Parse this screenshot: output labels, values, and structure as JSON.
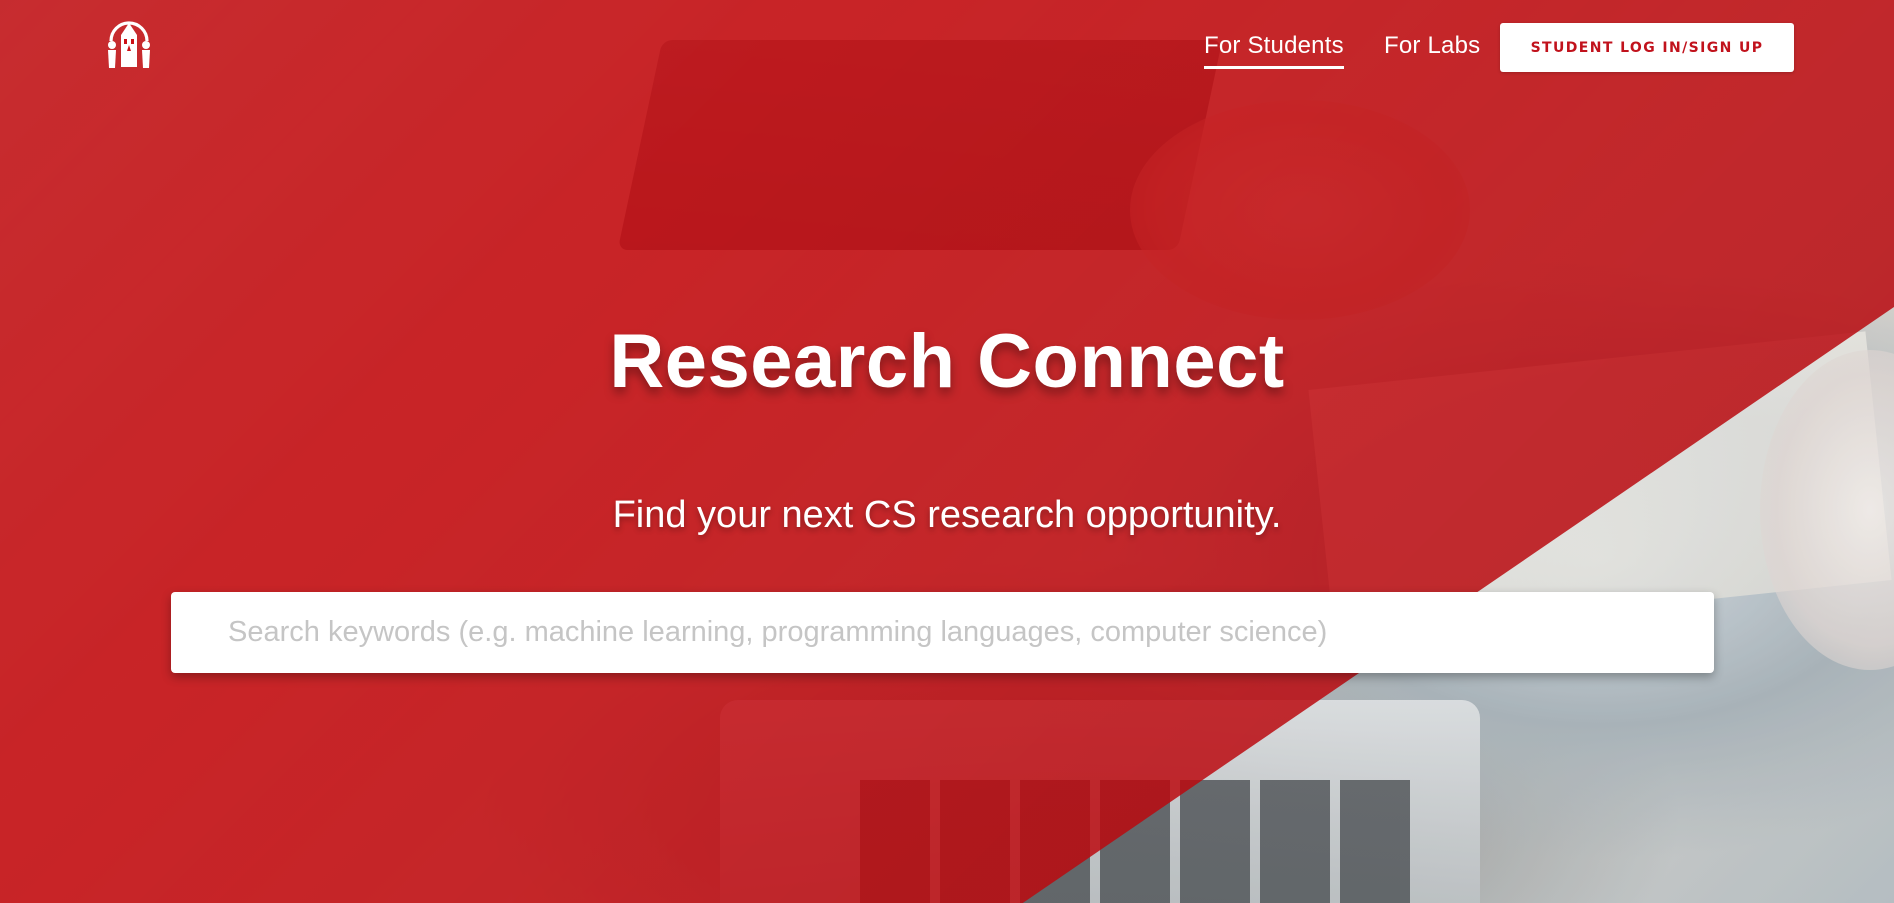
{
  "nav": {
    "for_students": "For Students",
    "for_labs": "For Labs",
    "login_button": "STUDENT LOG IN/SIGN UP"
  },
  "hero": {
    "title": "Research Connect",
    "subtitle": "Find your next CS research opportunity."
  },
  "search": {
    "placeholder": "Search keywords (e.g. machine learning, programming languages, computer science)",
    "value": ""
  },
  "colors": {
    "brand_red": "#cd1016",
    "button_text": "#c1121c",
    "white": "#ffffff"
  },
  "icons": {
    "logo": "research-team-logo-icon"
  }
}
